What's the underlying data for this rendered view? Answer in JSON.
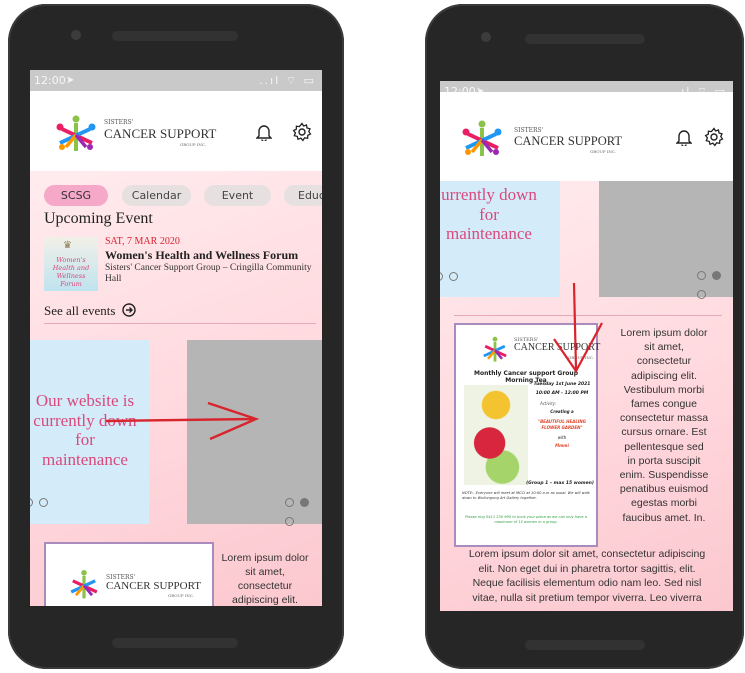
{
  "status": {
    "time": "12:00",
    "icons": "..ıl ⌔ ▭"
  },
  "logo": {
    "line1": "SISTERS'",
    "line2": "CANCER SUPPORT",
    "line3": "GROUP INC."
  },
  "tabs": [
    {
      "label": "SCSG",
      "active": true
    },
    {
      "label": "Calendar",
      "active": false
    },
    {
      "label": "Event",
      "active": false
    },
    {
      "label": "Educat",
      "active": false
    }
  ],
  "upcoming": {
    "heading": "Upcoming Event",
    "date": "SAT, 7 MAR 2020",
    "title": "Women's Health and Wellness Forum",
    "location": "Sisters' Cancer Support Group – Cringilla Community Hall",
    "thumb_text": "Women's Health and Wellness Forum",
    "see_all": "See all events"
  },
  "maintenance": {
    "full_lines": [
      "Our website is",
      "currently down",
      "for",
      "maintenance"
    ],
    "cropped_lines": [
      "urrently down",
      "for",
      "maintenance"
    ]
  },
  "lorem": {
    "left_col": [
      "Lorem ipsum dolor",
      "sit amet,",
      "consectetur",
      "adipiscing elit."
    ],
    "right_col": [
      "Lorem ipsum dolor",
      "sit amet,",
      "consectetur",
      "adipiscing elit.",
      "Vestibulum morbi",
      "fames congue",
      "consectetur massa",
      "cursus ornare. Est",
      "pellentesque sed",
      "in porta suscipit",
      "enim. Suspendisse",
      "penatibus euismod",
      "egestas morbi",
      "faucibus amet. In."
    ],
    "full": [
      "Lorem ipsum dolor sit amet, consectetur adipiscing",
      "elit. Non eget dui in pharetra tortor sagittis, elit.",
      "Neque facilisis elementum odio nam leo. Sed nisl",
      "vitae, nulla sit pretium tempor viverra. Leo viverra"
    ]
  },
  "poster": {
    "title": "Monthly Cancer support Group Morning Tea",
    "date": "Tuesday 1st June 2021",
    "time": "10:00 AM - 12:00 PM",
    "activity": "Activity:",
    "creating": "Creating a",
    "garden": "\"BEAUTIFUL HEALING FLOWER GARDEN\"",
    "with": "with",
    "host": "Mmmi",
    "group": "(Group 1 – max 15 women)",
    "note": "NOTE:- Everyone will meet at MCCI at 10:00 a.m as usual. We will walk down to Wollongong Art Gallery together.",
    "rsvp": "Please ring 0411 230 990 to book your place as we can only have a maximum of 15 women in a group."
  },
  "colors": {
    "accent": "#d9497c",
    "arrow": "#d8242c",
    "pill_active": "#f6a8c8"
  }
}
